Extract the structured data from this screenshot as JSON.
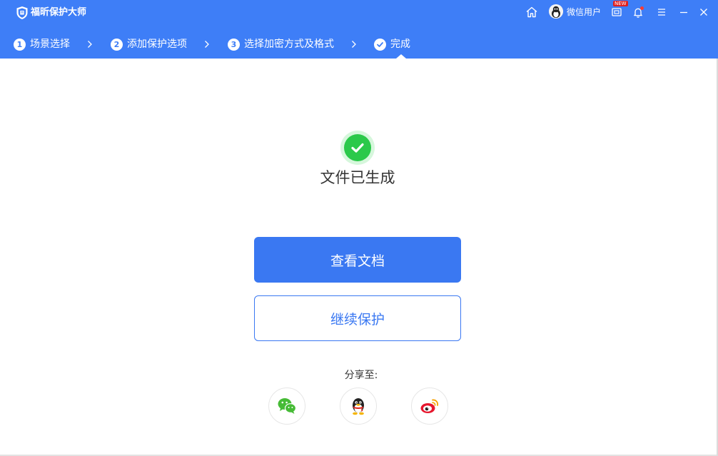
{
  "app": {
    "title": "福昕保护大师"
  },
  "titlebar": {
    "username": "微信用户",
    "new_badge": "NEW"
  },
  "steps": [
    {
      "num": "1",
      "label": "场景选择"
    },
    {
      "num": "2",
      "label": "添加保护选项"
    },
    {
      "num": "3",
      "label": "选择加密方式及格式"
    },
    {
      "num": "",
      "label": "完成"
    }
  ],
  "result": {
    "title": "文件已生成"
  },
  "buttons": {
    "view_doc": "查看文档",
    "continue_protect": "继续保护"
  },
  "share": {
    "label": "分享至:",
    "targets": [
      "wechat-icon",
      "qq-icon",
      "weibo-icon"
    ]
  },
  "colors": {
    "header": "#3e7ef7",
    "primary": "#3a78f2",
    "success": "#2bc94a"
  }
}
